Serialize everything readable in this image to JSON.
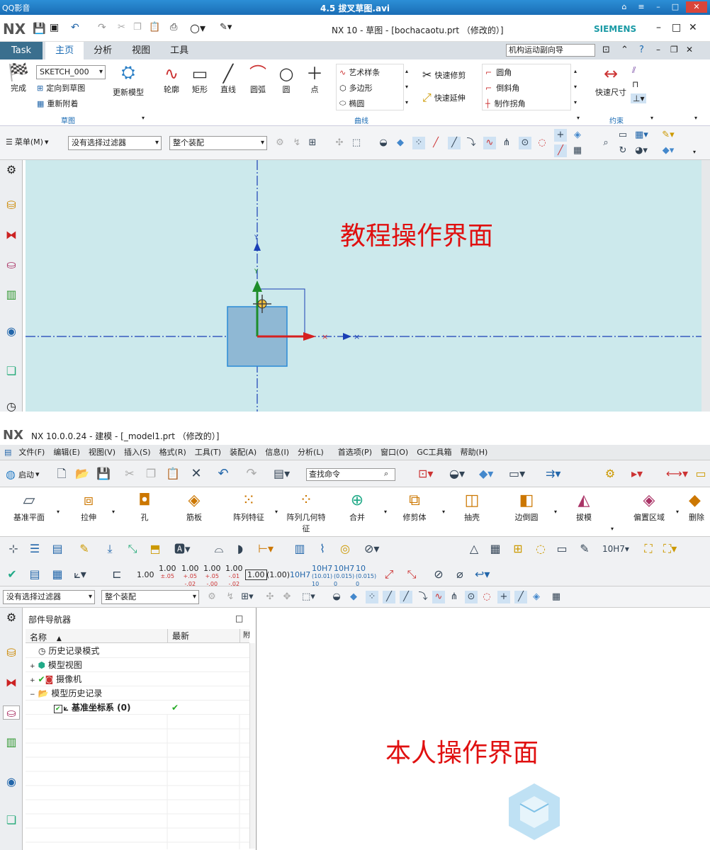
{
  "player": {
    "logo": "QQ影音",
    "title": "4.5 拔叉草图.avi"
  },
  "nx1": {
    "logo": "NX",
    "title": "NX 10 - 草图 - [bochacaotu.prt （修改的）]",
    "brand": "SIEMENS",
    "tabs": [
      "Task",
      "主页",
      "分析",
      "视图",
      "工具"
    ],
    "search_value": "机构运动副向导",
    "sketch_name": "SKETCH_000",
    "ribbon": {
      "finish": "完成",
      "orient": "定向到草图",
      "reattach": "重新附着",
      "update": "更新模型",
      "profile": "轮廓",
      "rect": "矩形",
      "line": "直线",
      "arc": "圆弧",
      "circle": "圆",
      "point": "点",
      "spline": "艺术样条",
      "polygon": "多边形",
      "ellipse": "椭圆",
      "trim": "快速修剪",
      "extend": "快速延伸",
      "fillet": "圆角",
      "chamfer": "倒斜角",
      "corner": "制作拐角",
      "rapid_dim": "快速尺寸",
      "grp_sketch": "草图",
      "grp_curve": "曲线",
      "grp_constraint": "约束"
    },
    "menu_btn": "菜单(M)",
    "filter": "没有选择过滤器",
    "assembly": "整个装配",
    "overlay_label": "教程操作界面"
  },
  "nx2": {
    "logo": "NX",
    "title": "NX 10.0.0.24 - 建模 - [_model1.prt （修改的）]",
    "menu": [
      "文件(F)",
      "编辑(E)",
      "视图(V)",
      "插入(S)",
      "格式(R)",
      "工具(T)",
      "装配(A)",
      "信息(I)",
      "分析(L)",
      "首选项(P)",
      "窗口(O)",
      "GC工具箱",
      "帮助(H)"
    ],
    "start": "启动",
    "find_cmd": "查找命令",
    "features": [
      "基准平面",
      "拉伸",
      "孔",
      "筋板",
      "阵列特征",
      "阵列几何特征",
      "合并",
      "修剪体",
      "抽壳",
      "边倒圆",
      "拔模",
      "偏置区域",
      "删除"
    ],
    "tol_labels": [
      "1.00",
      "1.00",
      "1.00",
      "1.00",
      "1.00",
      "1.00",
      "(1.00)",
      "10H7",
      "10H7",
      "10H7",
      "10",
      "10H7"
    ],
    "filter": "没有选择过滤器",
    "assembly": "整个装配",
    "nav": {
      "title": "部件导航器",
      "col_name": "名称",
      "col_latest": "最新",
      "col_extra": "附",
      "rows": [
        "历史记录模式",
        "模型视图",
        "摄像机",
        "模型历史记录",
        "基准坐标系 (0)"
      ]
    },
    "overlay_label": "本人操作界面"
  }
}
